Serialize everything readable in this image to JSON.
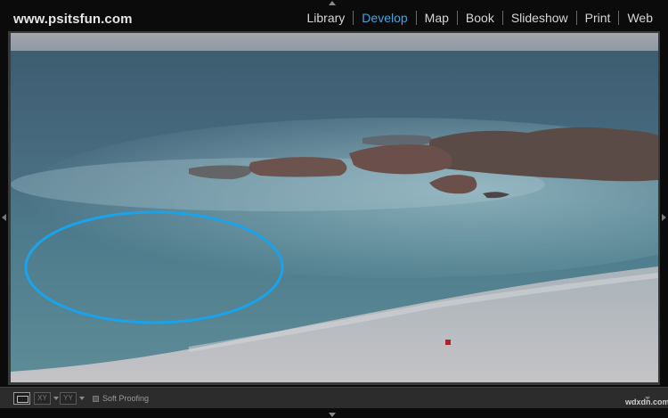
{
  "identity_plate": "www.psitsfun.com",
  "modules": [
    {
      "label": "Library",
      "active": false
    },
    {
      "label": "Develop",
      "active": true
    },
    {
      "label": "Map",
      "active": false
    },
    {
      "label": "Book",
      "active": false
    },
    {
      "label": "Slideshow",
      "active": false
    },
    {
      "label": "Print",
      "active": false
    },
    {
      "label": "Web",
      "active": false
    }
  ],
  "toolbar": {
    "soft_proofing_label": "Soft Proofing",
    "compare_label": "XY",
    "survey_label": "YY"
  },
  "watermark": "wdxdn.com",
  "colors": {
    "active_module": "#49a3dd",
    "annotation_ellipse": "#1aa3ea",
    "background": "#0b0b0b"
  }
}
